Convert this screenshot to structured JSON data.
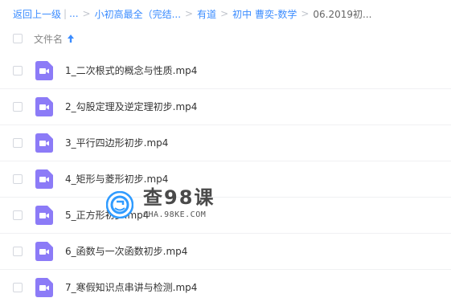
{
  "breadcrumb": {
    "back": "返回上一级",
    "ellipsis": "...",
    "items": [
      "小初高最全（完结...",
      "有道",
      "初中 曹奕-数学"
    ],
    "current": "06.2019初..."
  },
  "header": {
    "column_title": "文件名"
  },
  "files": [
    {
      "name": "1_二次根式的概念与性质.mp4"
    },
    {
      "name": "2_勾股定理及逆定理初步.mp4"
    },
    {
      "name": "3_平行四边形初步.mp4"
    },
    {
      "name": "4_矩形与菱形初步.mp4"
    },
    {
      "name": "5_正方形初步.mp4"
    },
    {
      "name": "6_函数与一次函数初步.mp4"
    },
    {
      "name": "7_寒假知识点串讲与检测.mp4"
    }
  ],
  "watermark": {
    "title": "查98课",
    "subtitle": "CHA.98KE.COM"
  },
  "colors": {
    "link": "#3b8cff",
    "video_icon": "#8c7bf7",
    "text": "#333333"
  },
  "icons": {
    "sort": "arrow-up-icon",
    "file": "video-file-icon"
  }
}
